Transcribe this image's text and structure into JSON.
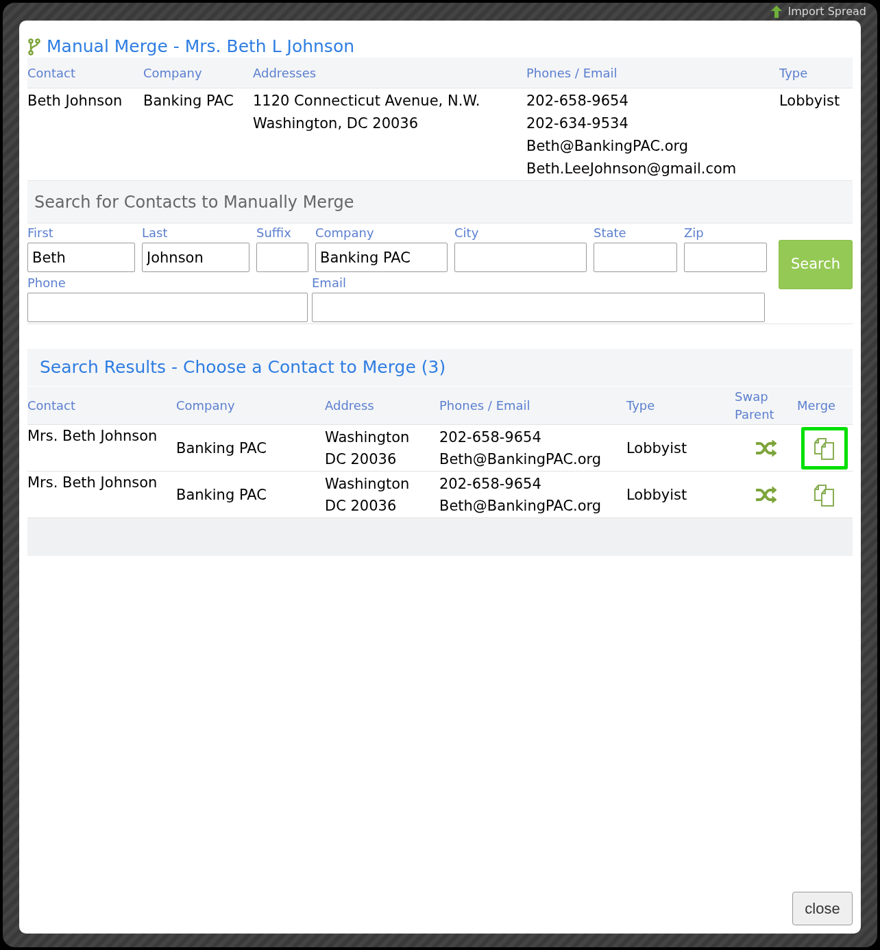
{
  "background": {
    "button": "Import Spread"
  },
  "dialog": {
    "title": "Manual Merge - Mrs. Beth L Johnson",
    "contact_table": {
      "columns": [
        "Contact",
        "Company",
        "Addresses",
        "Phones / Email",
        "Type"
      ],
      "row": {
        "contact": "Beth Johnson",
        "company": "Banking PAC",
        "addresses": [
          "1120 Connecticut Avenue, N.W.",
          "Washington, DC 20036"
        ],
        "phones_email": [
          "202-658-9654",
          "202-634-9534",
          "Beth@BankingPAC.org",
          "Beth.LeeJohnson@gmail.com"
        ],
        "type": "Lobbyist"
      }
    },
    "search_form": {
      "heading": "Search for Contacts to Manually Merge",
      "fields": [
        {
          "label": "First",
          "value": "Beth"
        },
        {
          "label": "Last",
          "value": "Johnson"
        },
        {
          "label": "Suffix"
        },
        {
          "label": "Company",
          "value": "Banking PAC"
        },
        {
          "label": "City"
        },
        {
          "label": "State"
        },
        {
          "label": "Zip"
        },
        {
          "label": "Phone"
        },
        {
          "label": "Email"
        }
      ],
      "button": "Search"
    },
    "results": {
      "heading": "Search Results - Choose a Contact to Merge (3)",
      "columns": [
        "Contact",
        "Company",
        "Address",
        "Phones / Email",
        "Type",
        "Swap Parent",
        "Merge"
      ],
      "rows": [
        {
          "contact": "Mrs. Beth Johnson",
          "company": "Banking PAC",
          "address": [
            "Washington",
            "DC 20036"
          ],
          "phones_email": [
            "202-658-9654",
            "Beth@BankingPAC.org"
          ],
          "type": "Lobbyist",
          "selected": true
        },
        {
          "contact": "Mrs. Beth Johnson",
          "company": "Banking PAC",
          "address": [
            "Washington",
            "DC 20036"
          ],
          "phones_email": [
            "202-658-9654",
            "Beth@BankingPAC.org"
          ],
          "type": "Lobbyist",
          "selected": false
        }
      ]
    },
    "close_button": "close"
  }
}
